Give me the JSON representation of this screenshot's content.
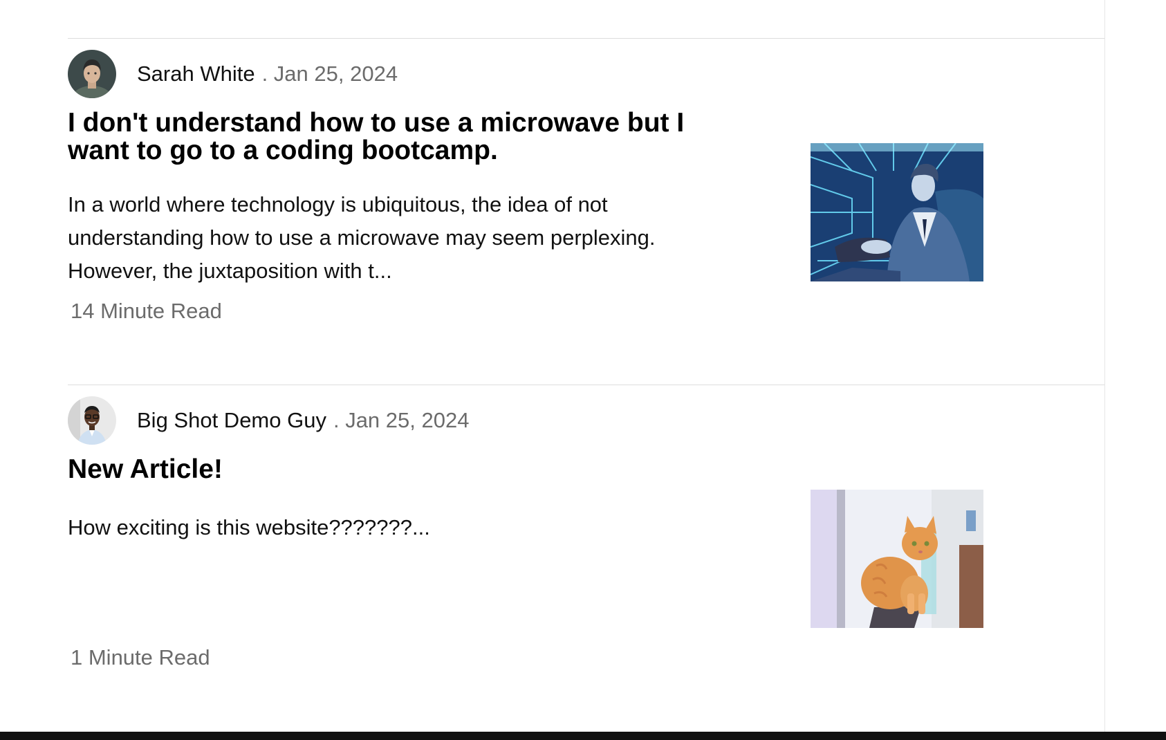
{
  "articles": [
    {
      "author": "Sarah White",
      "date": ". Jan 25, 2024",
      "title": "I don't understand how to use a microwave but I want to go to a coding bootcamp.",
      "excerpt": "In a world where technology is ubiquitous, the idea of not understanding how to use a microwave may seem perplexing. However, the juxtaposition with t...",
      "read_time": "14 Minute Read"
    },
    {
      "author": "Big Shot Demo Guy",
      "date": ". Jan 25, 2024",
      "title": "New Article!",
      "excerpt": "How exciting is this website???????...",
      "read_time": "1 Minute Read"
    }
  ]
}
